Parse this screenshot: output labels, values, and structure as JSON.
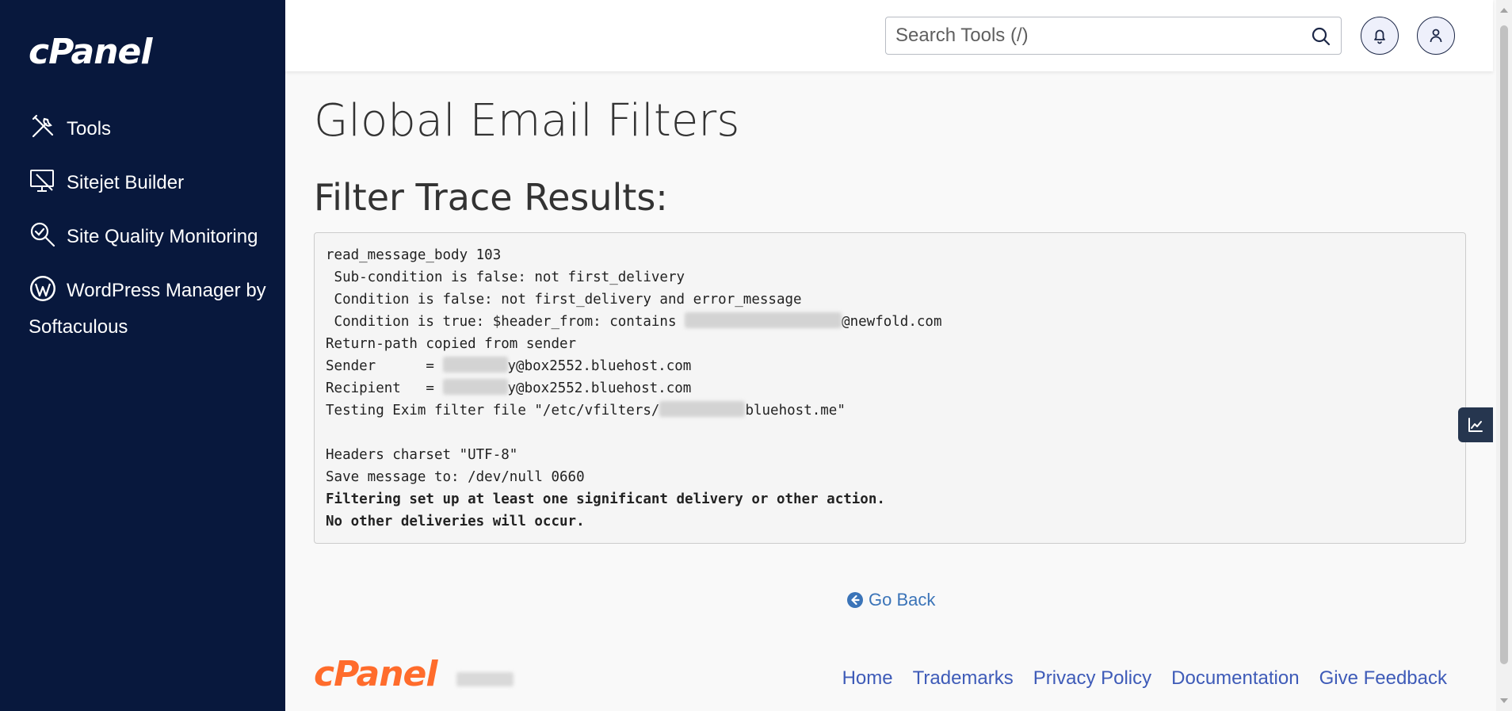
{
  "sidebar": {
    "logo": "cPanel",
    "items": [
      {
        "label": "Tools",
        "icon": "tools-icon"
      },
      {
        "label": "Sitejet Builder",
        "icon": "monitor-brush-icon"
      },
      {
        "label": "Site Quality Monitoring",
        "icon": "magnifier-check-icon"
      },
      {
        "label": "WordPress Manager by Softaculous",
        "icon": "wordpress-icon"
      }
    ],
    "bg_color": "#08183d"
  },
  "header": {
    "search_placeholder": "Search Tools (/)",
    "search_value": ""
  },
  "main": {
    "page_title": "Global Email Filters",
    "section_title": "Filter Trace Results:",
    "trace": {
      "l1": "read_message_body 103",
      "l2": " Sub-condition is false: not first_delivery",
      "l3": " Condition is false: not first_delivery and error_message",
      "l4a": " Condition is true: $header_from: contains ",
      "l4b": "@newfold.com",
      "l5": "Return-path copied from sender",
      "l6a": "Sender      = ",
      "l6b": "y@box2552.bluehost.com",
      "l7a": "Recipient   = ",
      "l7b": "y@box2552.bluehost.com",
      "l8a": "Testing Exim filter file \"/etc/vfilters/",
      "l8b": "bluehost.me\"",
      "l9": "Headers charset \"UTF-8\"",
      "l10": "Save message to: /dev/null 0660",
      "l11": "Filtering set up at least one significant delivery or other action.",
      "l12": "No other deliveries will occur."
    },
    "go_back": "Go Back"
  },
  "footer": {
    "logo": "cPanel",
    "links": [
      "Home",
      "Trademarks",
      "Privacy Policy",
      "Documentation",
      "Give Feedback"
    ]
  },
  "colors": {
    "accent_orange": "#ff6c2c",
    "link_blue": "#3e5bb8",
    "goback_blue": "#3b74b8"
  }
}
